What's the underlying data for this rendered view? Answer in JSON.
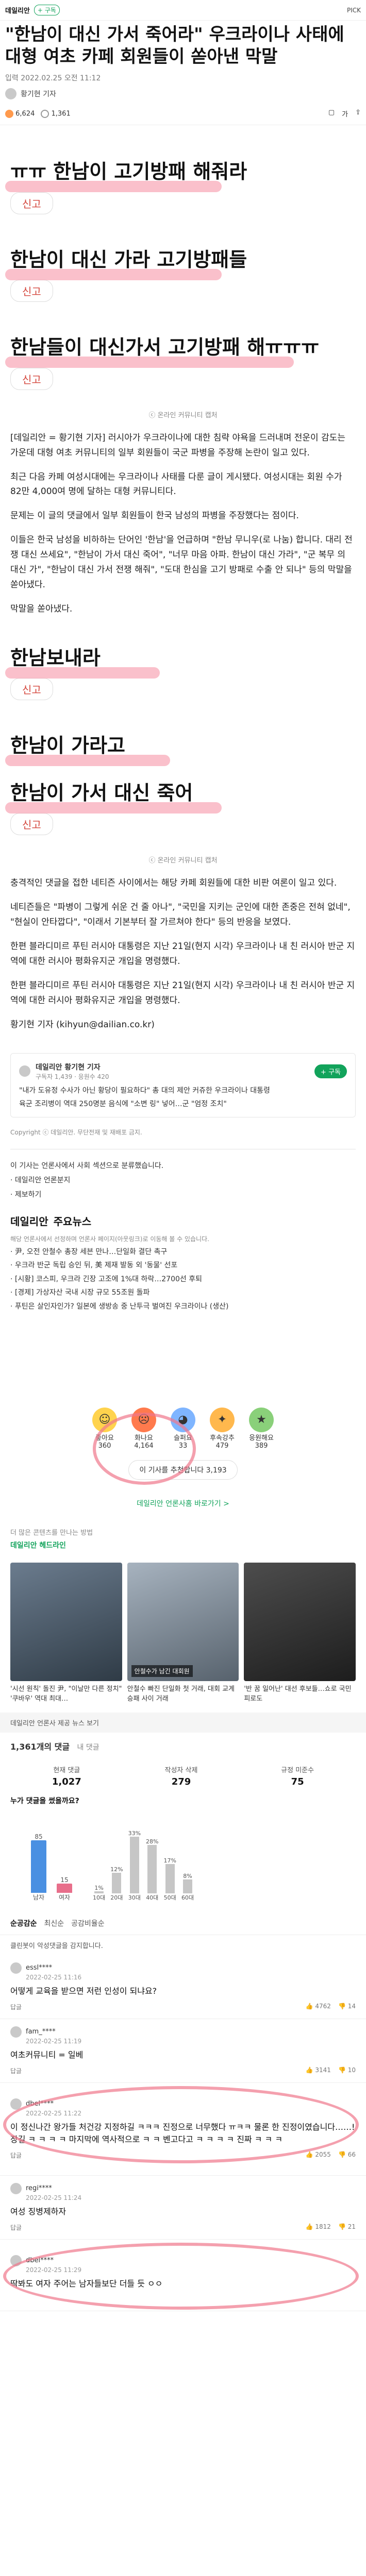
{
  "topbar": {
    "brand": "데일리안",
    "subscribe": "+ 구독",
    "right": "PICK"
  },
  "article": {
    "title": "\"한남이 대신 가서 죽어라\" 우크라이나 사태에 대형 여초 카페 회원들이 쏟아낸 막말",
    "date": "입력 2022.02.25 오전 11:12",
    "reporter": "황기현 기자",
    "stat_views": "6,624",
    "stat_comments": "1,361"
  },
  "screenshots": [
    {
      "text": "ㅠㅠ 한남이 고기방패 해줘라",
      "reply": "신고"
    },
    {
      "text": "한남이 대신 가라 고기방패들",
      "reply": "신고"
    },
    {
      "text": "한남들이 대신가서 고기방패 해ㅠㅠㅠ",
      "reply": "신고"
    }
  ],
  "caption1": "ⓒ 온라인 커뮤니티 캡처",
  "body1": [
    "[데일리안 = 황기현 기자] 러시아가 우크라이나에 대한 침략 야욕을 드러내며 전운이 감도는 가운데 대형 여초 커뮤니티의 일부 회원들이 국군 파병을 주장해 논란이 일고 있다.",
    "최근 다음 카페 여성시대에는 우크라이나 사태를 다룬 글이 게시됐다. 여성시대는 회원 수가 82만 4,000여 명에 달하는 대형 커뮤니티다.",
    "문제는 이 글의 댓글에서 일부 회원들이 한국 남성의 파병을 주장했다는 점이다.",
    "이들은 한국 남성을 비하하는 단어인 '한남'을 언급하며 \"한남 무니우(로 나눔) 합니다. 대리 전쟁 대신 쓰세요\", \"한남이 가서 대신 죽어\", \"너무 마음 아파. 한남이 대신 가라\", \"군 복무 의 대신 가\", \"한남이 대신 가서 전쟁 해줘\", \"도대 한심을 고기 방패로 수출 안 되나\" 등의 막말을 쏟아냈다.",
    "막말을 쏟아냈다."
  ],
  "screenshots2": [
    {
      "text": "한남보내라",
      "reply": "신고"
    },
    {
      "text": "한남이 가라고",
      "reply": ""
    },
    {
      "text": "한남이 가서 대신 죽어",
      "reply": "신고"
    }
  ],
  "caption2": "ⓒ 온라인 커뮤니티 캡처",
  "body2": [
    "충격적인 댓글을 접한 네티즌 사이에서는 해당 카페 회원들에 대한 비판 여론이 일고 있다.",
    "네티즌들은 \"파병이 그렇게 쉬운 건 줄 아나\", \"국민을 지키는 군인에 대한 존중은 전혀 없네\", \"현실이 안타깝다\", \"이래서 기본부터 잘 가르쳐야 한다\" 등의 반응을 보였다.",
    "한편 블라디미르 푸틴 러시아 대통령은 지난 21일(현지 시각) 우크라이나 내 친 러시아 반군 지역에 대한 러시아 평화유지군 개입을 명령했다.",
    "한편 블라디미르 푸틴 러시아 대통령은 지난 21일(현지 시각) 우크라이나 내 친 러시아 반군 지역에 대한 러시아 평화유지군 개입을 명령했다.",
    "황기현 기자 (kihyun@dailian.co.kr)"
  ],
  "related": {
    "name": "데일리안 황기현 기자",
    "stats": "구독자 1,439 · 응원수 420",
    "subscribe": "+ 구독",
    "items": [
      "\"내가 도유정 수사가 아닌 황당이 필요하다\" 총 대의 제안 커쥬한 우크라이나 대통령",
      "육군 조리병이 역대 250명분 음식에 \"소변 링\" 넣어…군 \"엄정 조치\""
    ]
  },
  "copyright": "Copyright ⓒ 데일리안. 무단전재 및 재배포 금지.",
  "links": [
    "이 기사는 언론사에서 사회 섹션으로 분류했습니다.",
    "· 데일리안 언론분지",
    "· 제보하기"
  ],
  "news": {
    "brand": "데일리안",
    "title": "주요뉴스",
    "sub": "해당 언론사에서 선정하며 언론사 페이지(아웃링크)로 이동해 볼 수 있습니다.",
    "items": [
      "· 尹, 오전 안철수 총장 세븐 만나…단일화 결단 촉구",
      "· 우크라 반군 독립 승인 뒤, 美 제재 발동 외 '동물' 선포",
      "· [시황] 코스피, 우크라 긴장 고조에 1%대 하락…2700선 후퇴",
      "· [경제] 가상자산 국내 시장 규모 55조원 돌파",
      "· 푸틴은 살인자인가? 일본에 생방송 중 난투극 벌여진 우크라이나 (생산)"
    ]
  },
  "reactions": [
    {
      "label": "좋아요",
      "count": "360",
      "emoji": "☺",
      "color": "#ffd34d"
    },
    {
      "label": "화나요",
      "count": "4,164",
      "emoji": "☹",
      "color": "#ff7a4d"
    },
    {
      "label": "슬퍼요",
      "count": "33",
      "emoji": "◕",
      "color": "#7fb5ff"
    },
    {
      "label": "후속강추",
      "count": "479",
      "emoji": "✦",
      "color": "#ffb84d"
    },
    {
      "label": "응원해요",
      "count": "389",
      "emoji": "★",
      "color": "#8ad07a"
    }
  ],
  "recommend": "이 기사를 추천합니다 3,193",
  "brand_link": "데일리안 언론사홈 바로가기 >",
  "more": {
    "label": "더 많은 콘텐츠를 만나는 방법",
    "brand": "데일리안 헤드라인",
    "items": [
      {
        "title": "'시선 원칙' 돌진 尹, \"이날만 다른 정치\" '쿠바우' 역대 최대…",
        "tag": ""
      },
      {
        "title": "안철수 빠진 단일화 첫 거래, 대회 교계 승패 사이 거래",
        "tag": "안철수가 남긴 대회원"
      },
      {
        "title": "'반 꿈 일어난' 대선 후보들…쇼로 국민 피로도",
        "tag": ""
      }
    ]
  },
  "section_bar": "데일리안 언론사 제공 뉴스 보기",
  "comments_summary": {
    "count": "1,361개의 댓글",
    "sub": "내 댓글",
    "cols": [
      {
        "label": "현재 댓글",
        "num": "1,027"
      },
      {
        "label": "작성자 삭제",
        "num": "279"
      },
      {
        "label": "규정 미준수",
        "num": "75"
      }
    ],
    "who_title": "누가 댓글을 썼을까요?"
  },
  "gender_chart": {
    "type": "bar",
    "categories": [
      "남자",
      "여자"
    ],
    "values": [
      85,
      15
    ]
  },
  "age_chart": {
    "type": "bar",
    "categories": [
      "10대",
      "20대",
      "30대",
      "40대",
      "50대",
      "60대"
    ],
    "values": [
      1,
      12,
      33,
      28,
      17,
      8
    ]
  },
  "sort_tabs": [
    "순공감순",
    "최신순",
    "공감비율순"
  ],
  "clean_bot": "클린봇이 악성댓글을 감지합니다.",
  "comments": [
    {
      "user": "essl****",
      "time": "2022-02-25 11:16",
      "text": "어떻게 교육을 받으면 저런 인성이 되냐요?",
      "up": "4762",
      "down": "14"
    },
    {
      "user": "fam_****",
      "time": "2022-02-25 11:19",
      "text": "여초커뮤니티 = 일베",
      "up": "3141",
      "down": "10"
    },
    {
      "user": "dbel****",
      "time": "2022-02-25 11:22",
      "text": "이 정신나간 왕가들 처건강 지정하길 ㅋㅋㅋ 진정으로 너무했다 ㅠㅋㅋ 물론 한 진정이였습니다……! 장길 ㅋ ㅋ ㅋ ㅋ 마지막에 역사적으로 ㅋ ㅋ 벤고다고 ㅋ ㅋ ㅋ ㅋ 진짜 ㅋ ㅋ ㅋ",
      "up": "2055",
      "down": "66"
    },
    {
      "user": "regi****",
      "time": "2022-02-25 11:24",
      "text": "여성 징병제하자",
      "up": "1812",
      "down": "21"
    },
    {
      "user": "dbel****",
      "time": "2022-02-25 11:29",
      "text": "딱봐도 여자 주어는 남자들보단 더들 듯 ㅇㅇ",
      "up": "",
      "down": ""
    }
  ]
}
